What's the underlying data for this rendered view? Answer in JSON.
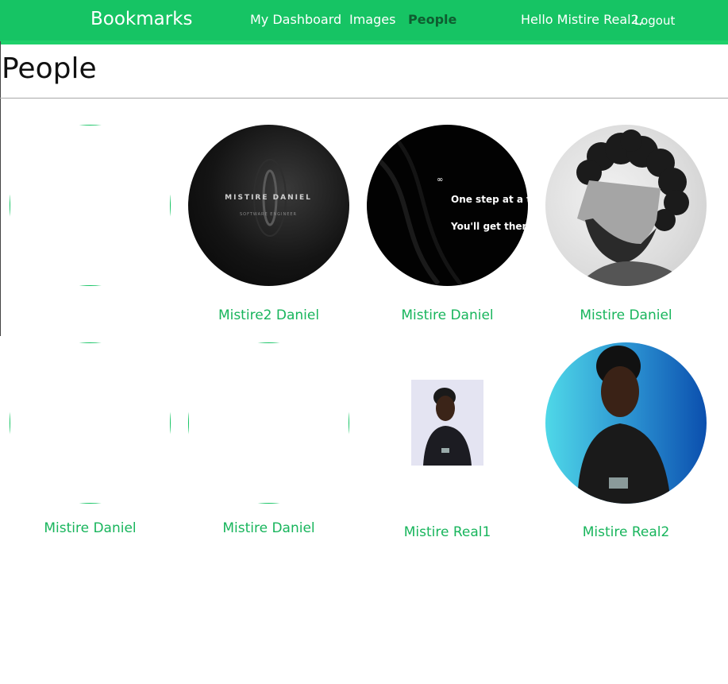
{
  "header": {
    "logo": "Bookmarks",
    "nav": [
      {
        "label": "My Dashboard"
      },
      {
        "label": "Images"
      },
      {
        "label": "People",
        "active": true
      }
    ],
    "greeting": "Hello Mistire Real2,",
    "logout": "Logout"
  },
  "page": {
    "title": "People"
  },
  "people": [
    {
      "name": "",
      "image": "empty"
    },
    {
      "name": "Mistire2 Daniel",
      "image": "dark-logo",
      "logo_text": "MISTIRE DANIEL",
      "logo_sub": "SOFTWARE ENGINEER"
    },
    {
      "name": "Mistire Daniel",
      "image": "quote",
      "quote_line1": "One step at a time,",
      "quote_line2": "You'll get there"
    },
    {
      "name": "Mistire Daniel",
      "image": "curly-portrait"
    },
    {
      "name": "Mistire Daniel",
      "image": "empty"
    },
    {
      "name": "Mistire Daniel",
      "image": "empty"
    },
    {
      "name": "Mistire Real1",
      "image": "small-photo"
    },
    {
      "name": "Mistire Real2",
      "image": "blue-portrait"
    }
  ],
  "colors": {
    "brand": "#16c464",
    "link": "#18b55c",
    "active_nav": "#0f5c30"
  }
}
